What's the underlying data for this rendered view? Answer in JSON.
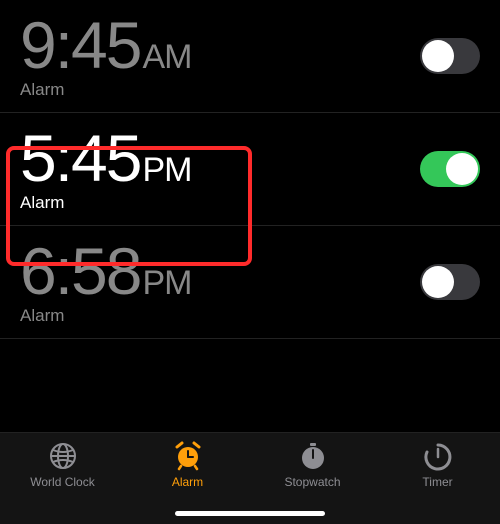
{
  "alarms": [
    {
      "time": "9:45",
      "period": "AM",
      "label": "Alarm",
      "enabled": false
    },
    {
      "time": "5:45",
      "period": "PM",
      "label": "Alarm",
      "enabled": true
    },
    {
      "time": "6:58",
      "period": "PM",
      "label": "Alarm",
      "enabled": false
    }
  ],
  "highlighted_index": 1,
  "tabs": {
    "world_clock": "World Clock",
    "alarm": "Alarm",
    "stopwatch": "Stopwatch",
    "timer": "Timer"
  },
  "active_tab": "alarm",
  "colors": {
    "accent": "#ff9f0a",
    "toggle_on": "#34c759",
    "highlight": "#ff2b2b"
  }
}
